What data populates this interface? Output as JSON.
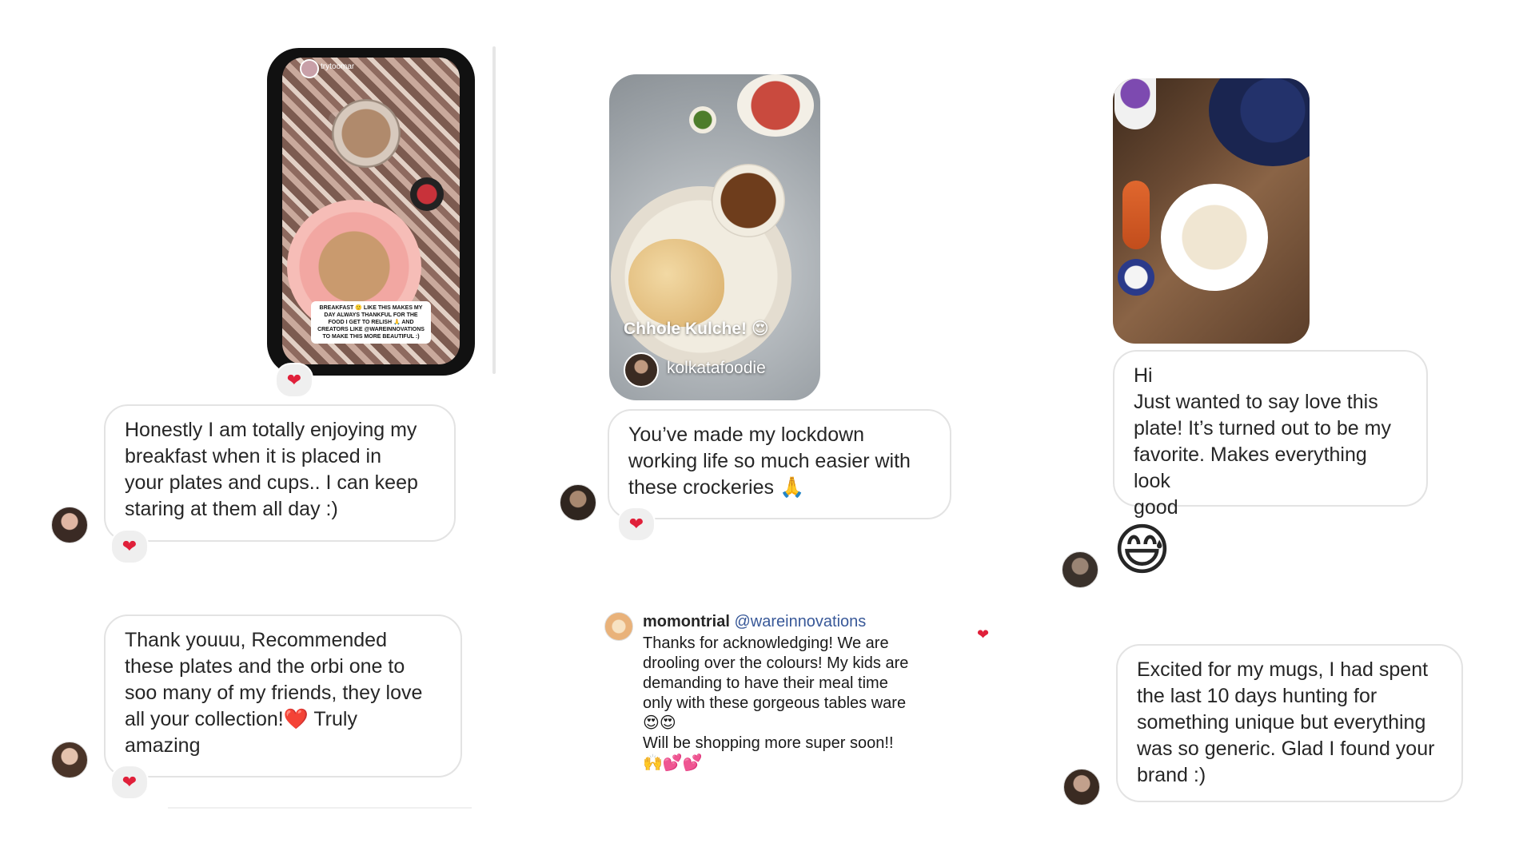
{
  "story_1": {
    "username": "trytoomar",
    "caption": "BREAKFAST 🙂 LIKE THIS MAKES MY DAY ALWAYS THANKFUL FOR THE FOOD I GET TO RELISH 🙏 AND CREATORS LIKE @WAREINNOVATIONS TO MAKE THIS MORE BEAUTIFUL :)",
    "reaction": "❤"
  },
  "post_2": {
    "overlay_text": "Chhole Kulche! 😍",
    "username": "kolkatafoodie"
  },
  "messages": {
    "m1": "Honestly I am totally enjoying my\nbreakfast when it is placed in\nyour plates and cups.. I can keep\nstaring at them all day :)",
    "m1_reaction": "❤",
    "m2": "Thank youuu, Recommended\nthese plates and the orbi one to\nsoo many of my friends, they love\nall your collection!❤️ Truly\namazing",
    "m2_reaction": "❤",
    "m3": "You’ve made my lockdown\nworking life so much easier with\nthese crockeries 🙏",
    "m3_reaction": "❤",
    "m4": "Hi\nJust wanted to say love this\nplate! It’s turned out to be my\nfavorite. Makes everything look\ngood",
    "m4_emoji": "😅",
    "m5": "Excited for my mugs, I had spent\nthe last 10 days hunting for\nsomething unique but everything\nwas so generic. Glad I found your\nbrand :)"
  },
  "comment": {
    "username": "momontrial",
    "mention": "@wareinnovations",
    "body": "Thanks for acknowledging! We are\ndrooling over the colours! My kids are\ndemanding to have their meal time\nonly with these gorgeous tables ware\n😍😍\nWill be shopping more super soon!!\n🙌💕💕",
    "like_icon": "❤"
  },
  "colors": {
    "bubble_border": "#e3e3e3",
    "heart_red": "#e0203a",
    "mention_blue": "#385898"
  }
}
